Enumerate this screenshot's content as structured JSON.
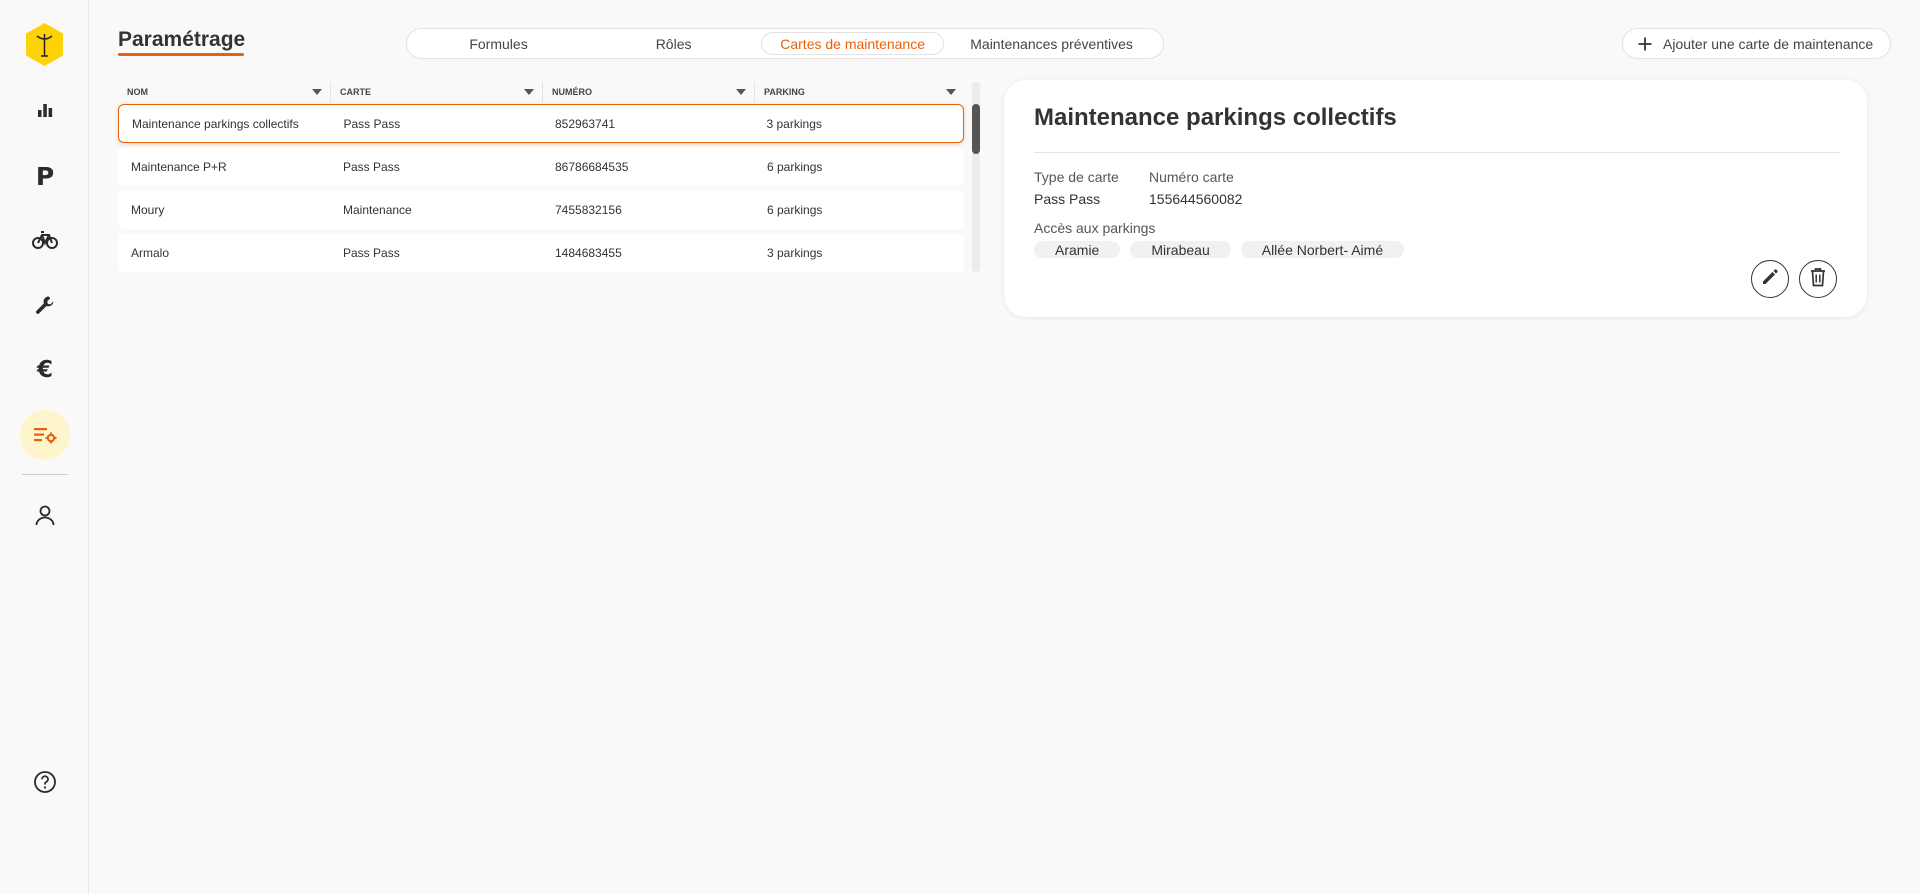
{
  "header": {
    "title": "Paramétrage",
    "add_button_label": "Ajouter une carte de maintenance"
  },
  "tabs": [
    {
      "label": "Formules",
      "active": false
    },
    {
      "label": "Rôles",
      "active": false
    },
    {
      "label": "Cartes de maintenance",
      "active": true
    },
    {
      "label": "Maintenances préventives",
      "active": false
    }
  ],
  "sidebar": {
    "items": [
      {
        "icon": "bar-chart-icon"
      },
      {
        "icon": "parking-icon",
        "glyph": "P"
      },
      {
        "icon": "bicycle-icon"
      },
      {
        "icon": "wrench-icon"
      },
      {
        "icon": "euro-icon",
        "glyph": "€"
      },
      {
        "icon": "settings-list-icon",
        "active": true
      },
      {
        "icon": "user-icon"
      },
      {
        "icon": "help-icon"
      }
    ]
  },
  "table": {
    "columns": [
      "NOM",
      "CARTE",
      "NUMÉRO",
      "PARKING"
    ],
    "rows": [
      {
        "nom": "Maintenance parkings collectifs",
        "carte": "Pass Pass",
        "numero": "852963741",
        "parking": "3 parkings",
        "selected": true
      },
      {
        "nom": "Maintenance P+R",
        "carte": "Pass Pass",
        "numero": "86786684535",
        "parking": "6 parkings",
        "selected": false
      },
      {
        "nom": "Moury",
        "carte": "Maintenance",
        "numero": "7455832156",
        "parking": "6 parkings",
        "selected": false
      },
      {
        "nom": "Armalo",
        "carte": "Pass Pass",
        "numero": "1484683455",
        "parking": "3 parkings",
        "selected": false
      }
    ]
  },
  "detail": {
    "title": "Maintenance parkings collectifs",
    "card_type_label": "Type de carte",
    "card_type_value": "Pass Pass",
    "card_number_label": "Numéro carte",
    "card_number_value": "155644560082",
    "parkings_label": "Accès aux parkings",
    "parkings": [
      "Aramie",
      "Mirabeau",
      "Allée Norbert- Aimé"
    ]
  },
  "colors": {
    "accent": "#e8620e",
    "logo_yellow": "#fcd307",
    "active_nav_bg": "#fff5cc"
  }
}
